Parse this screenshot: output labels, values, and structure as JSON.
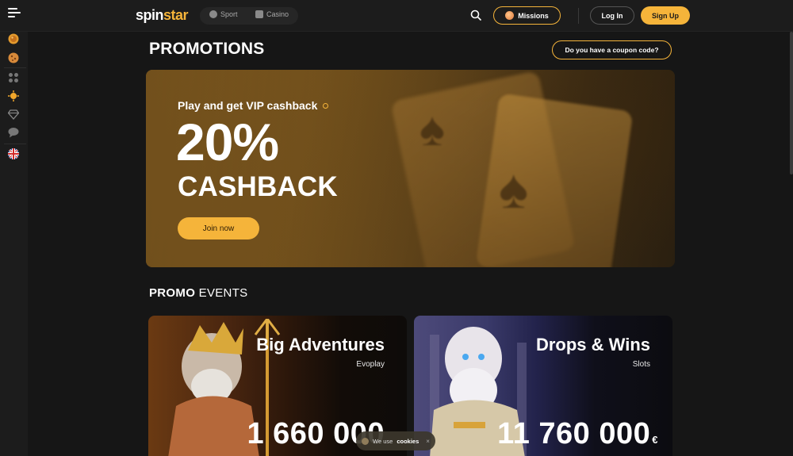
{
  "header": {
    "logo_part1": "spin",
    "logo_part2": "star",
    "sport_label": "Sport",
    "casino_label": "Casino",
    "missions_label": "Missions",
    "login_label": "Log In",
    "signup_label": "Sign Up"
  },
  "sidebar": {
    "icons": [
      "coin-icon",
      "cookie-icon",
      "dots-icon",
      "sun-icon",
      "diamond-icon",
      "chat-icon",
      "uk-flag-icon"
    ]
  },
  "main": {
    "page_title": "PROMOTIONS",
    "coupon_label": "Do you have a coupon code?",
    "hero": {
      "subtitle": "Play and get VIP cashback",
      "big": "20%",
      "mid": "CASHBACK",
      "cta": "Join now"
    },
    "section_bold": "PROMO",
    "section_rest": "EVENTS",
    "cards": [
      {
        "title": "Big Adventures",
        "provider": "Evoplay",
        "amount": "1 660 000",
        "currency": ""
      },
      {
        "title": "Drops & Wins",
        "provider": "Slots",
        "amount": "11 760 000",
        "currency": "€"
      }
    ]
  },
  "cookie": {
    "prefix": "We use",
    "bold": "cookies",
    "close": "×"
  },
  "colors": {
    "accent": "#f5b43a",
    "background": "#161616",
    "panel": "#1c1c1c"
  }
}
